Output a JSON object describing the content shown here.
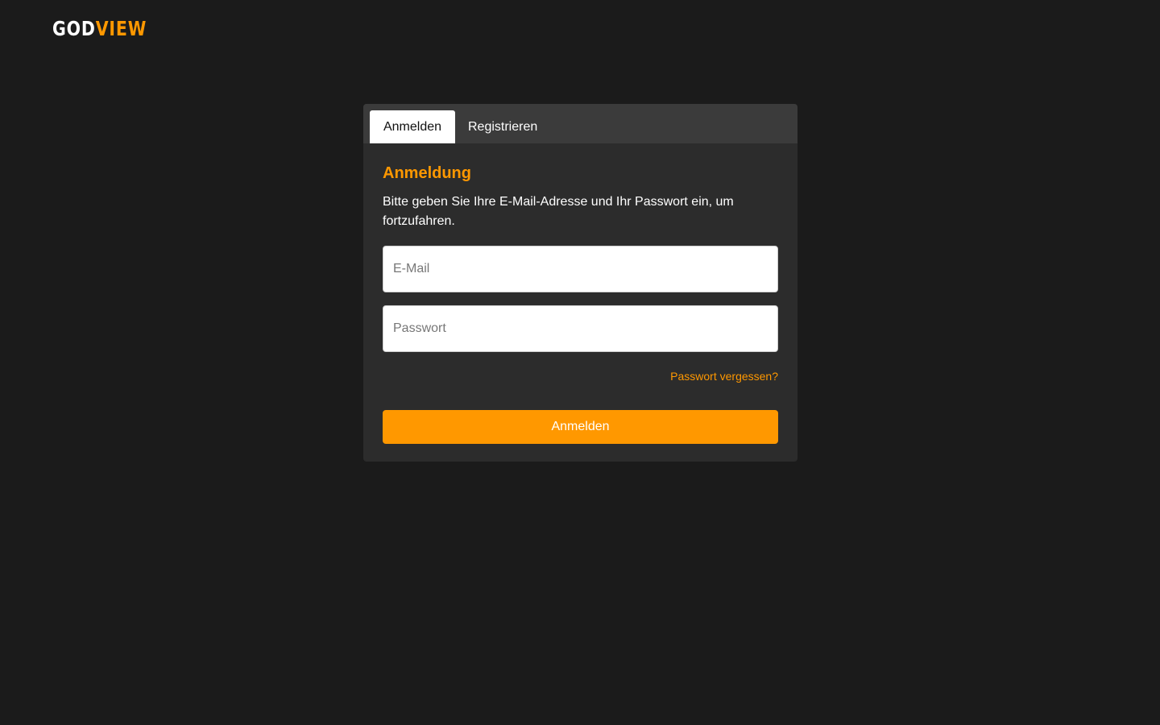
{
  "brand": {
    "logo_part_a": "GOD",
    "logo_part_b": "VIEW",
    "accent_color": "#ff9800",
    "background_color": "#1b1b1b"
  },
  "tabs": [
    {
      "label": "Anmelden",
      "active": true
    },
    {
      "label": "Registrieren",
      "active": false
    }
  ],
  "login": {
    "title": "Anmeldung",
    "description": "Bitte geben Sie Ihre E-Mail-Adresse und Ihr Passwort ein, um fortzufahren.",
    "email_placeholder": "E-Mail",
    "email_value": "",
    "password_placeholder": "Passwort",
    "password_value": "",
    "forgot_link": "Passwort vergessen?",
    "submit_label": "Anmelden"
  }
}
